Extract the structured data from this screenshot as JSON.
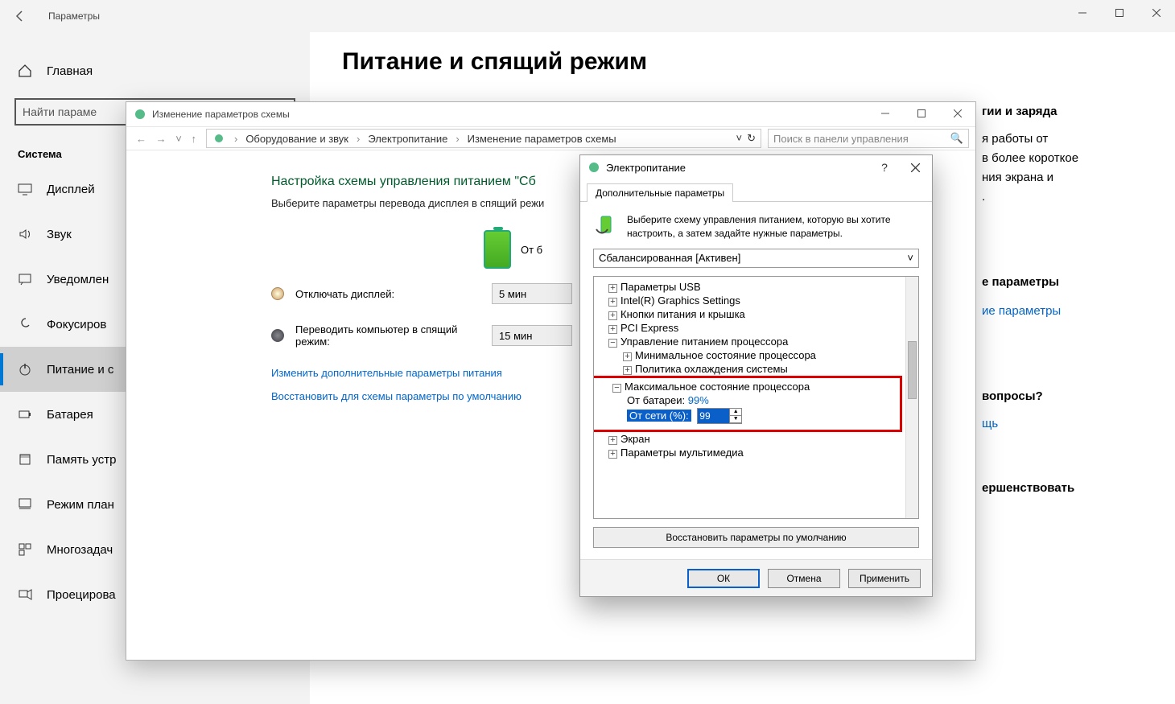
{
  "settings": {
    "window_title": "Параметры",
    "home": "Главная",
    "search_placeholder": "Найти параме",
    "category": "Система",
    "items": [
      "Дисплей",
      "Звук",
      "Уведомлен",
      "Фокусиров",
      "Питание и с",
      "Батарея",
      "Память устр",
      "Режим план",
      "Многозадач",
      "Проецирова"
    ],
    "active_index": 4,
    "page_title": "Питание и спящий режим"
  },
  "right_panel": {
    "h1": "гии и заряда",
    "p1a": "я работы от",
    "p1b": "в более короткое",
    "p1c": "ния экрана и",
    "p1d": ".",
    "h2": "е параметры",
    "link1": "ие параметры",
    "h3": "вопросы?",
    "link2": "щь",
    "h4": "ершенствовать"
  },
  "cp": {
    "title": "Изменение параметров схемы",
    "crumbs": [
      "Оборудование и звук",
      "Электропитание",
      "Изменение параметров схемы"
    ],
    "search_placeholder": "Поиск в панели управления",
    "heading": "Настройка схемы управления питанием \"Сб",
    "sub": "Выберите параметры перевода дисплея в спящий режи",
    "battery_label": "От б",
    "row_display": "Отключать дисплей:",
    "row_display_val": "5 мин",
    "row_sleep": "Переводить компьютер в спящий режим:",
    "row_sleep_val": "15 мин",
    "link_adv": "Изменить дополнительные параметры питания",
    "link_restore": "Восстановить для схемы параметры по умолчанию"
  },
  "dlg": {
    "title": "Электропитание",
    "tab": "Дополнительные параметры",
    "desc": "Выберите схему управления питанием, которую вы хотите настроить, а затем задайте нужные параметры.",
    "plan": "Сбалансированная [Активен]",
    "tree": {
      "usb": "Параметры USB",
      "intel": "Intel(R) Graphics Settings",
      "buttons": "Кнопки питания и крышка",
      "pci": "PCI Express",
      "cpu": "Управление питанием процессора",
      "cpu_min": "Минимальное состояние процессора",
      "cool": "Политика охлаждения системы",
      "cpu_max": "Максимальное состояние процессора",
      "on_battery": "От батареи:",
      "on_battery_val": "99%",
      "on_ac": "От сети (%):",
      "on_ac_val": "99",
      "screen": "Экран",
      "multimedia": "Параметры мультимедиа"
    },
    "restore": "Восстановить параметры по умолчанию",
    "ok": "ОК",
    "cancel": "Отмена",
    "apply": "Применить"
  }
}
